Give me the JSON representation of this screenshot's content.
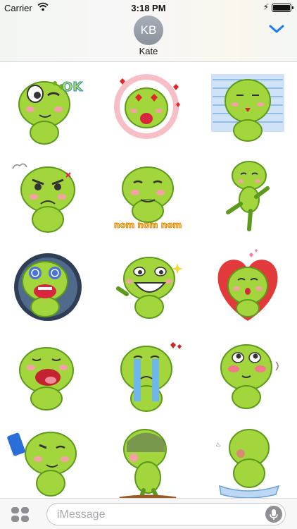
{
  "status_bar": {
    "carrier": "Carrier",
    "time": "3:18 PM"
  },
  "header": {
    "avatar_initials": "KB",
    "contact_name": "Kate"
  },
  "stickers": [
    {
      "name": "sticker-frog-ok",
      "caption": "OK"
    },
    {
      "name": "sticker-frog-heart-eyes",
      "caption": ""
    },
    {
      "name": "sticker-frog-blue-shock",
      "caption": ""
    },
    {
      "name": "sticker-frog-angry",
      "caption": ""
    },
    {
      "name": "sticker-frog-nom",
      "caption": "nom nom nom"
    },
    {
      "name": "sticker-frog-dancing",
      "caption": ""
    },
    {
      "name": "sticker-frog-dark-scream",
      "caption": ""
    },
    {
      "name": "sticker-frog-grin",
      "caption": ""
    },
    {
      "name": "sticker-frog-kiss-heart",
      "caption": ""
    },
    {
      "name": "sticker-frog-yawn",
      "caption": ""
    },
    {
      "name": "sticker-frog-crying",
      "caption": ""
    },
    {
      "name": "sticker-frog-blush",
      "caption": ""
    },
    {
      "name": "sticker-frog-selfie",
      "caption": ""
    },
    {
      "name": "sticker-frog-sad-walk",
      "caption": ""
    },
    {
      "name": "sticker-frog-bath-towel",
      "caption": ""
    }
  ],
  "composer": {
    "placeholder": "iMessage"
  },
  "colors": {
    "frog_green": "#a3d63c",
    "frog_dark": "#6fae23",
    "blush": "#f6a1a6",
    "ios_blue": "#1a7cf5"
  }
}
